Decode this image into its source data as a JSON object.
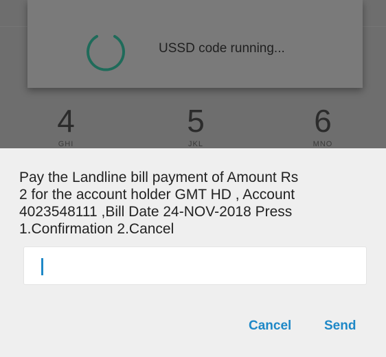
{
  "progress_dialog": {
    "message": "USSD code running..."
  },
  "dialpad_keys": [
    {
      "digit": "4",
      "letters": "GHI"
    },
    {
      "digit": "5",
      "letters": "JKL"
    },
    {
      "digit": "6",
      "letters": "MNO"
    }
  ],
  "response_dialog": {
    "message": "Pay the Landline bill payment of Amount Rs\n2 for the account holder GMT HD   , Account\n4023548111 ,Bill Date  24-NOV-2018 Press\n1.Confirmation 2.Cancel",
    "input_value": "",
    "cancel_label": "Cancel",
    "send_label": "Send"
  },
  "colors": {
    "accent": "#1e88c7",
    "spinner": "#1f6b5a",
    "dim_overlay": "#6e6e6e",
    "dialog_bg": "#efefef"
  }
}
